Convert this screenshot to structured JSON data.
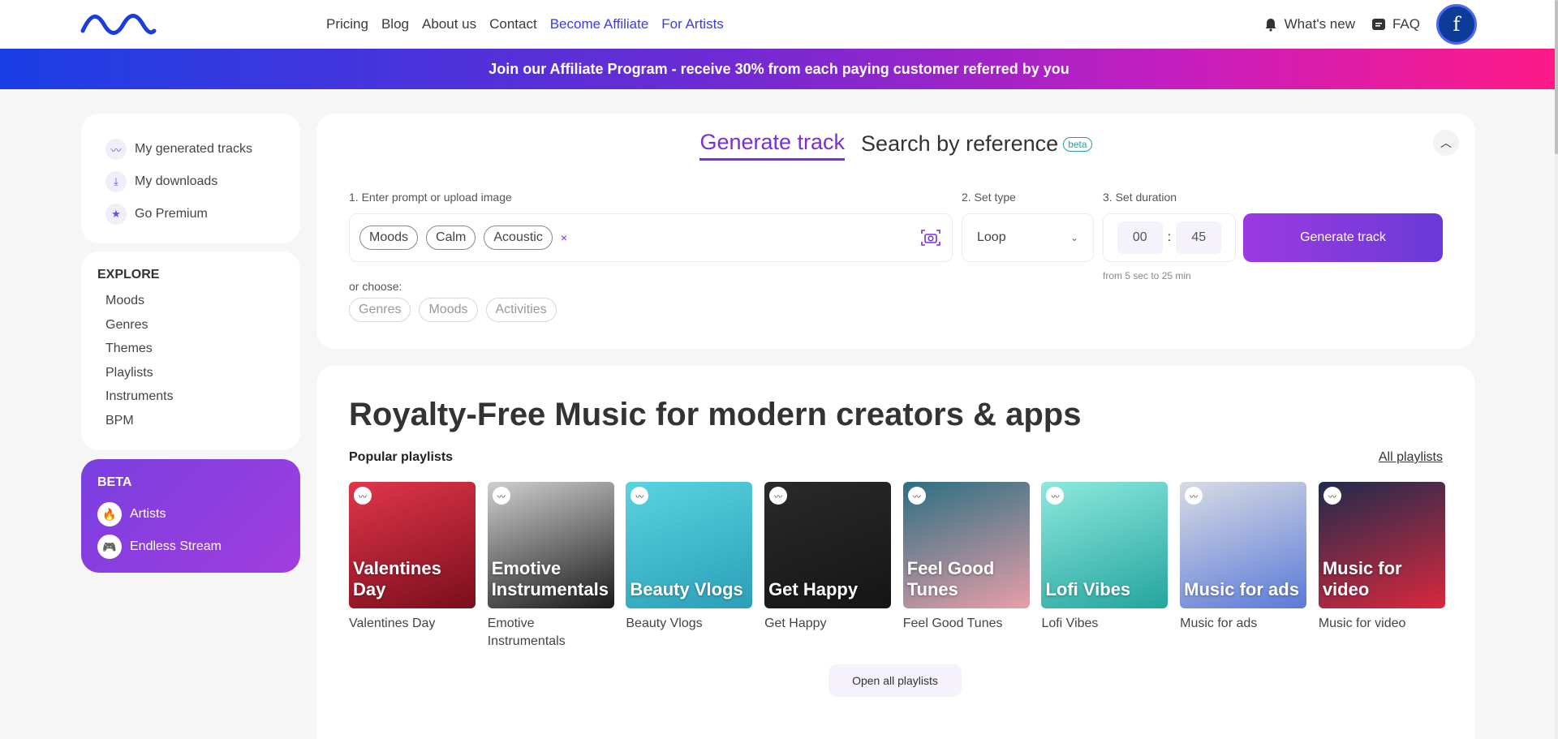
{
  "header": {
    "logo": "wave-logo",
    "nav": [
      {
        "label": "Pricing"
      },
      {
        "label": "Blog"
      },
      {
        "label": "About us"
      },
      {
        "label": "Contact"
      },
      {
        "label": "Become Affiliate"
      },
      {
        "label": "For Artists"
      }
    ],
    "whats_new": "What's new",
    "faq": "FAQ",
    "avatar_letter": "f"
  },
  "banner": {
    "text": "Join our Affiliate Program - receive 30% from each paying customer referred by you"
  },
  "sidebar": {
    "top_items": [
      {
        "label": "My generated tracks",
        "icon": "wave-icon"
      },
      {
        "label": "My downloads",
        "icon": "download-icon"
      },
      {
        "label": "Go Premium",
        "icon": "star-icon"
      }
    ],
    "explore_title": "EXPLORE",
    "explore_items": [
      "Moods",
      "Genres",
      "Themes",
      "Playlists",
      "Instruments",
      "BPM"
    ],
    "beta_title": "BETA",
    "beta_items": [
      {
        "label": "Artists",
        "icon": "fire-icon"
      },
      {
        "label": "Endless Stream",
        "icon": "gamepad-icon"
      }
    ]
  },
  "generator": {
    "tab_active": "Generate track",
    "tab_inactive": "Search by reference",
    "beta_badge": "beta",
    "step1": "1. Enter prompt or upload image",
    "step2": "2. Set type",
    "step3": "3. Set duration",
    "chips": [
      "Moods",
      "Calm",
      "Acoustic"
    ],
    "clear": "×",
    "type_value": "Loop",
    "duration_min": "00",
    "duration_sep": ":",
    "duration_sec": "45",
    "duration_hint": "from 5 sec to 25 min",
    "generate_button": "Generate track",
    "or_choose": "or choose:",
    "options": [
      "Genres",
      "Moods",
      "Activities"
    ]
  },
  "main": {
    "heading": "Royalty-Free Music for modern creators & apps",
    "popular": "Popular playlists",
    "all_playlists": "All playlists",
    "playlists": [
      {
        "title": "Valentines Day",
        "caption": "Valentines Day",
        "colors": [
          "#e0364a",
          "#7a0e1c"
        ]
      },
      {
        "title": "Emotive Instrumentals",
        "caption": "Emotive Instrumentals",
        "colors": [
          "#cfcfcf",
          "#1a1a1a"
        ]
      },
      {
        "title": "Beauty Vlogs",
        "caption": "Beauty Vlogs",
        "colors": [
          "#5ad3e0",
          "#2a9fb8"
        ]
      },
      {
        "title": "Get Happy",
        "caption": "Get Happy",
        "colors": [
          "#2a2a2a",
          "#151515"
        ]
      },
      {
        "title": "Feel Good Tunes",
        "caption": "Feel Good Tunes",
        "colors": [
          "#2c6f82",
          "#e79ea8"
        ]
      },
      {
        "title": "Lofi Vibes",
        "caption": "Lofi Vibes",
        "colors": [
          "#8ee8de",
          "#23a59e"
        ]
      },
      {
        "title": "Music for ads",
        "caption": "Music for ads",
        "colors": [
          "#d8dbe4",
          "#5a7ad8"
        ]
      },
      {
        "title": "Music for video",
        "caption": "Music for video",
        "colors": [
          "#1f2b4d",
          "#d9283c"
        ]
      }
    ],
    "open_all": "Open all playlists"
  }
}
